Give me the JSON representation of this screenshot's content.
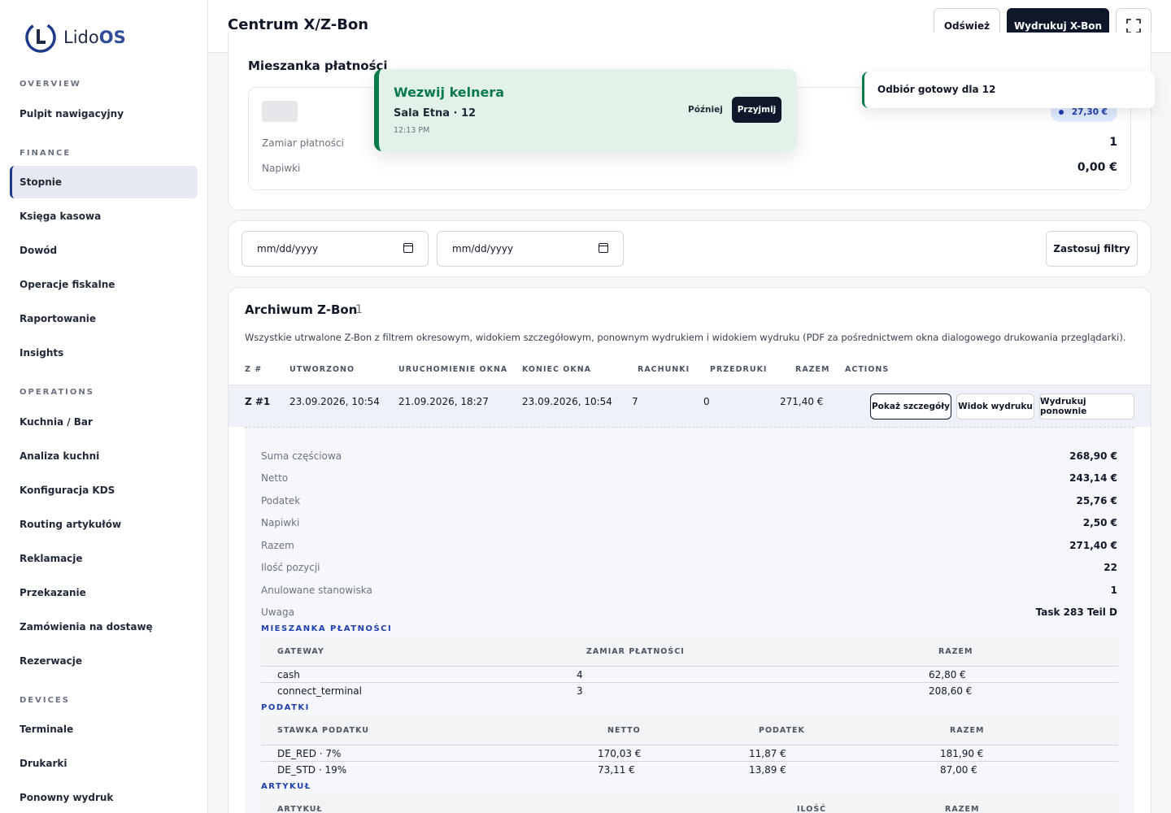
{
  "brand": {
    "name_regular": "Lido",
    "name_bold": "OS"
  },
  "sidebar": {
    "sections": [
      {
        "title": "OVERVIEW",
        "items": [
          "Pulpit nawigacyjny"
        ]
      },
      {
        "title": "FINANCE",
        "items": [
          "Stopnie",
          "Księga kasowa",
          "Dowód",
          "Operacje fiskalne",
          "Raportowanie",
          "Insights"
        ]
      },
      {
        "title": "OPERATIONS",
        "items": [
          "Kuchnia / Bar",
          "Analiza kuchni",
          "Konfiguracja KDS",
          "Routing artykułów",
          "Reklamacje",
          "Przekazanie",
          "Zamówienia na dostawę",
          "Rezerwacje"
        ]
      },
      {
        "title": "DEVICES",
        "items": [
          "Terminale",
          "Drukarki",
          "Ponowny wydruk"
        ]
      }
    ],
    "active": "Stopnie"
  },
  "header": {
    "title": "Centrum X/Z-Bon",
    "refresh_label": "Odśwież",
    "print_x_label": "Wydrukuj X-Bon",
    "fullscreen_icon": "fullscreen-icon"
  },
  "payment_mix": {
    "title": "Mieszanka płatności",
    "badge": "27,30 €",
    "rows": [
      {
        "label": "Zamiar płatności",
        "value": "1"
      },
      {
        "label": "Napiwki",
        "value": "0,00 €"
      }
    ]
  },
  "filters": {
    "date_from_placeholder": "mm/dd/yyyy",
    "date_to_placeholder": "mm/dd/yyyy",
    "apply_label": "Zastosuj filtry"
  },
  "archive": {
    "title": "Archiwum Z-Bon",
    "count": "1",
    "description": "Wszystkie utrwalone Z-Bon z filtrem okresowym, widokiem szczegółowym, ponownym wydrukiem i widokiem wydruku (PDF za pośrednictwem okna dialogowego drukowania przeglądarki).",
    "columns": [
      "Z #",
      "UTWORZONO",
      "URUCHOMIENIE OKNA",
      "KONIEC OKNA",
      "RACHUNKI",
      "PRZEDRUKI",
      "RAZEM",
      "ACTIONS"
    ],
    "row": {
      "z": "Z #1",
      "created": "23.09.2026, 10:54",
      "window_start": "21.09.2026, 18:27",
      "window_end": "23.09.2026, 10:54",
      "receipts": "7",
      "reprints": "0",
      "total": "271,40 €",
      "actions": [
        "Pokaż szczegóły",
        "Widok wydruku",
        "Wydrukuj ponownie"
      ]
    },
    "details": [
      {
        "label": "Suma częściowa",
        "value": "268,90 €"
      },
      {
        "label": "Netto",
        "value": "243,14 €"
      },
      {
        "label": "Podatek",
        "value": "25,76 €"
      },
      {
        "label": "Napiwki",
        "value": "2,50 €"
      },
      {
        "label": "Razem",
        "value": "271,40 €"
      },
      {
        "label": "Ilość pozycji",
        "value": "22"
      },
      {
        "label": "Anulowane stanowiska",
        "value": "1"
      },
      {
        "label": "Uwaga",
        "value": "Task 283 Teil D"
      }
    ],
    "payment_mix": {
      "title": "MIESZANKA PŁATNOŚCI",
      "columns": [
        "GATEWAY",
        "ZAMIAR PŁATNOŚCI",
        "RAZEM"
      ],
      "rows": [
        [
          "cash",
          "4",
          "62,80 €"
        ],
        [
          "connect_terminal",
          "3",
          "208,60 €"
        ]
      ]
    },
    "taxes": {
      "title": "PODATKI",
      "columns": [
        "STAWKA PODATKU",
        "NETTO",
        "PODATEK",
        "RAZEM"
      ],
      "rows": [
        [
          "DE_RED · 7%",
          "170,03 €",
          "11,87 €",
          "181,90 €"
        ],
        [
          "DE_STD · 19%",
          "73,11 €",
          "13,89 €",
          "87,00 €"
        ]
      ]
    },
    "articles": {
      "title": "ARTYKUŁ",
      "columns": [
        "ARTYKUŁ",
        "ILOŚĆ",
        "RAZEM"
      ]
    }
  },
  "toast_waiter": {
    "title": "Wezwij kelnera",
    "subtitle": "Sala Etna · 12",
    "time": "12:13 PM",
    "later_label": "Później",
    "accept_label": "Przyjmij"
  },
  "toast_pickup": {
    "text": "Odbiór gotowy dla 12"
  }
}
